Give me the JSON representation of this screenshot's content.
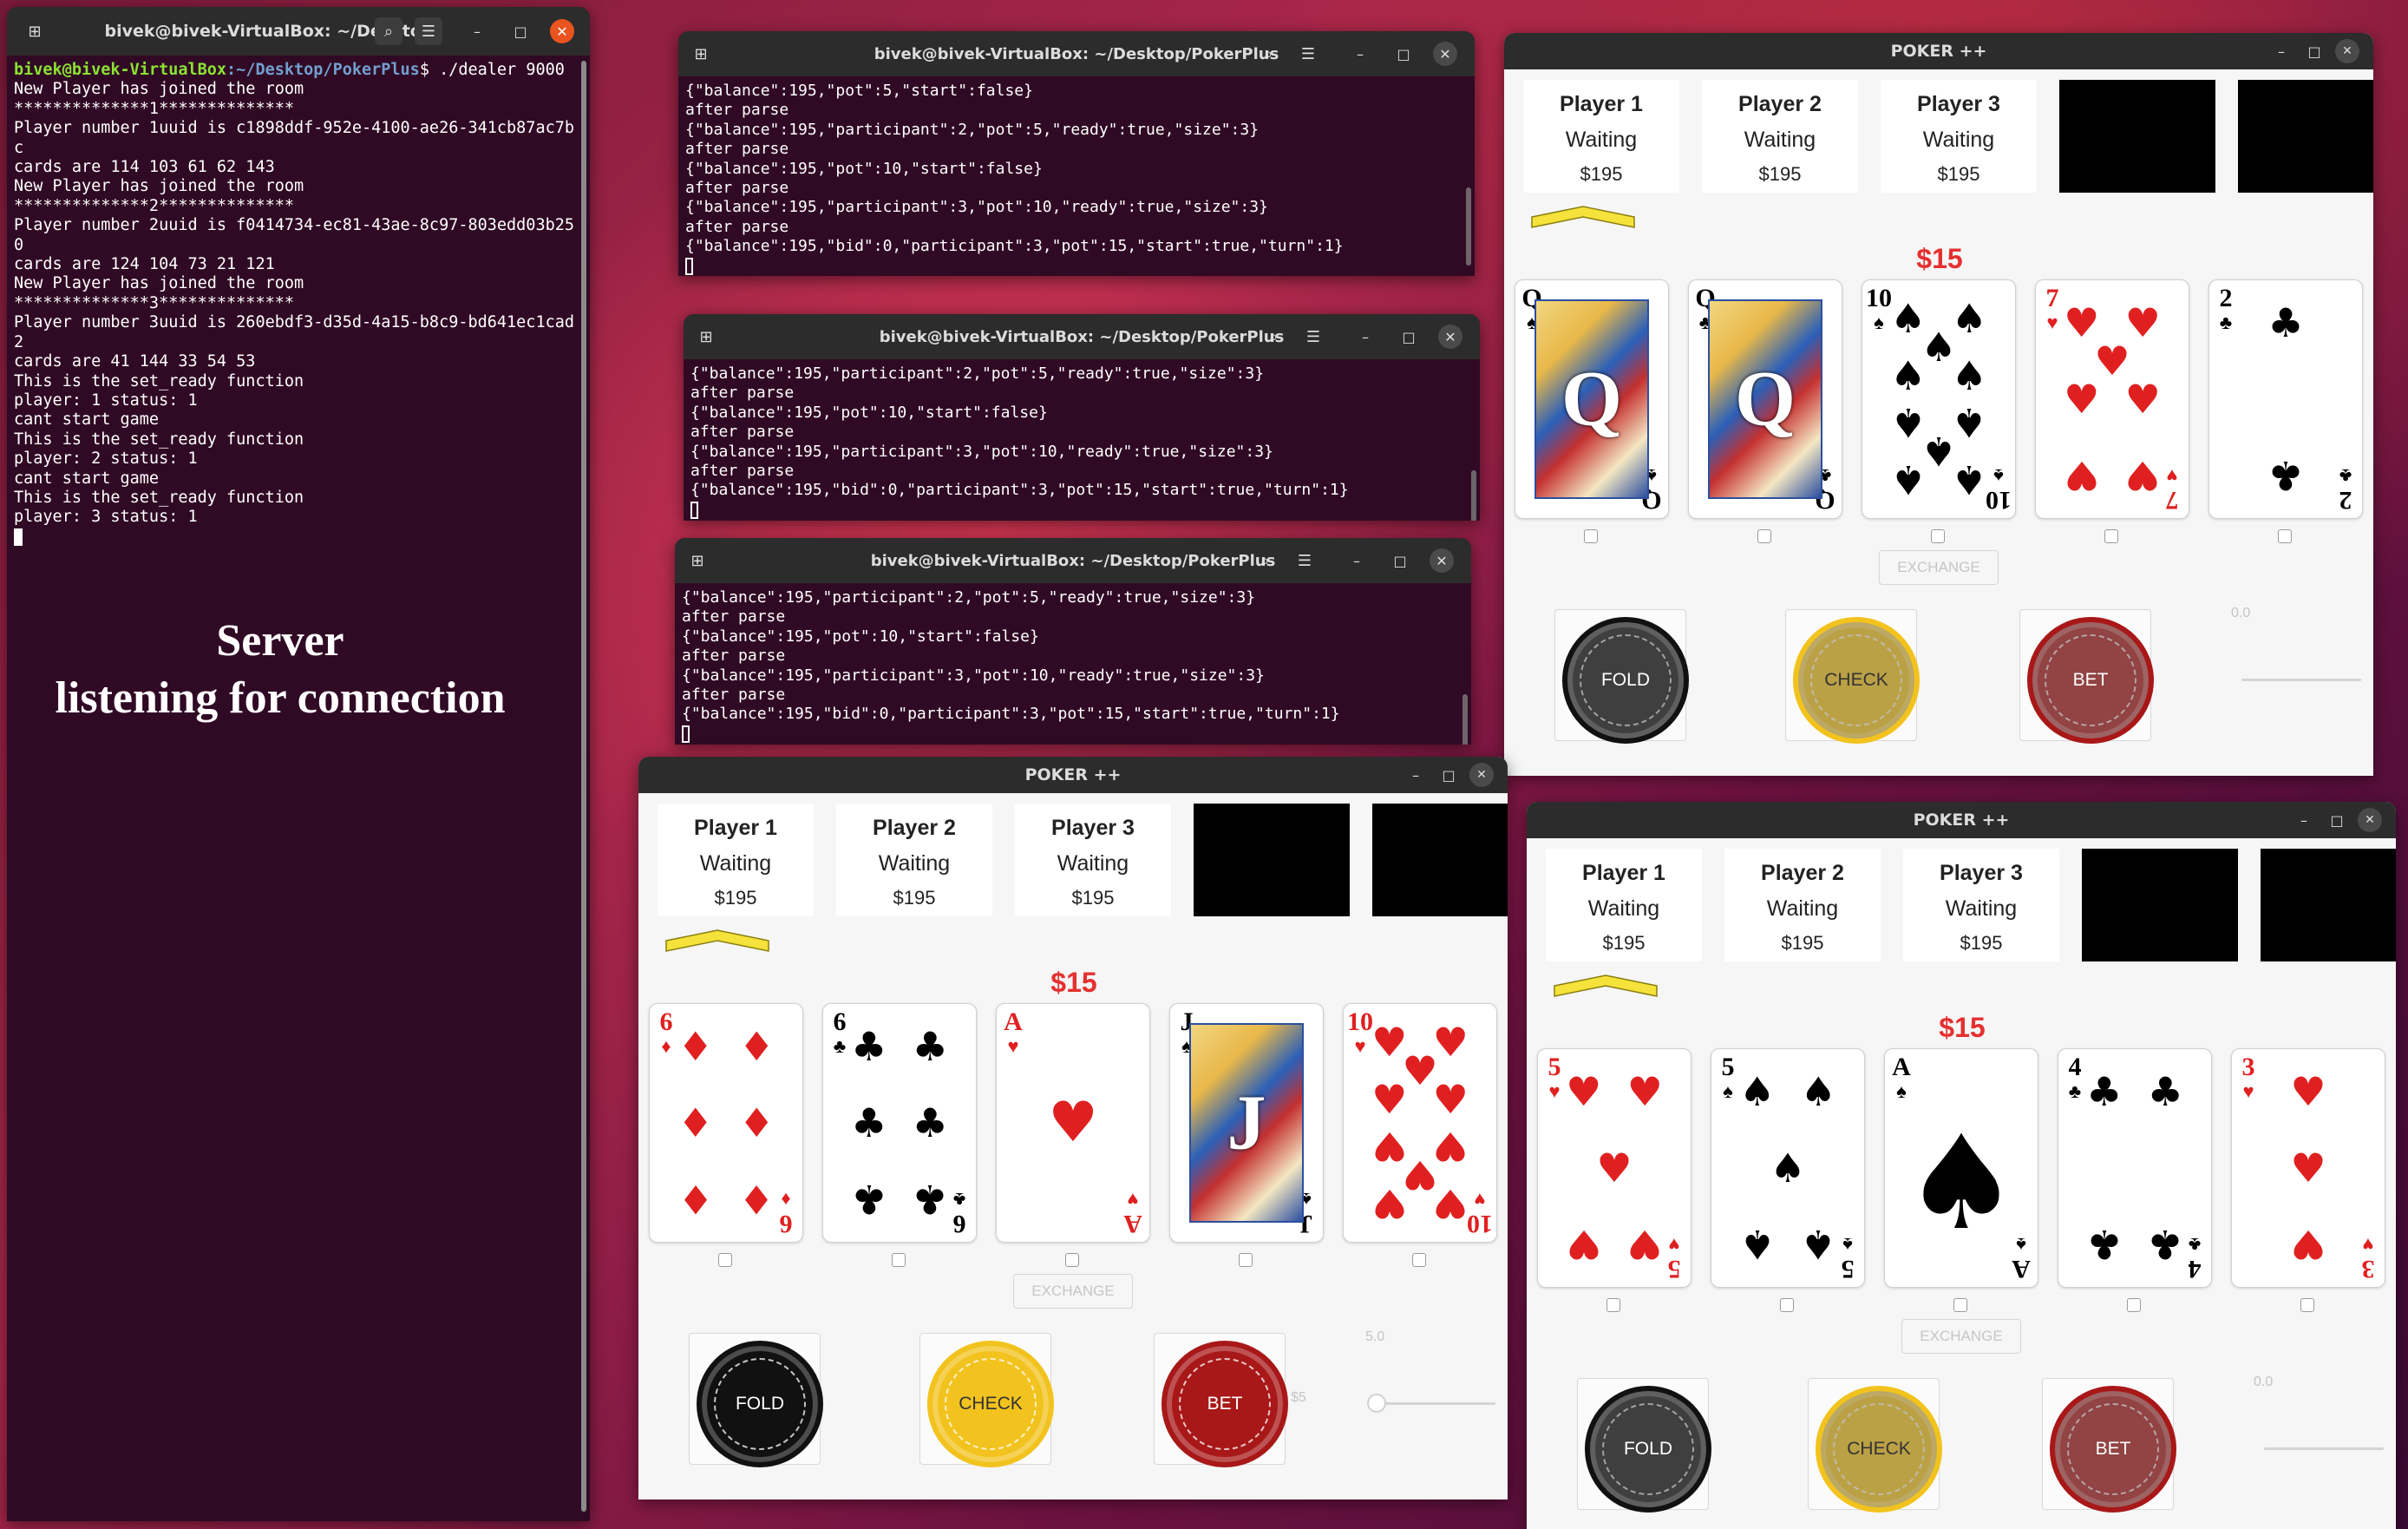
{
  "server_terminal": {
    "title": "bivek@bivek-VirtualBox: ~/Deskto...",
    "prompt_user": "bivek@bivek-VirtualBox",
    "prompt_path": ":~/Desktop/PokerPlus",
    "prompt_cmd": "$ ./dealer 9000",
    "lines": [
      "New Player has joined the room",
      "**************1**************",
      "Player number 1uuid is c1898ddf-952e-4100-ae26-341cb87ac7b",
      "c",
      "cards are 114 103 61 62 143",
      "New Player has joined the room",
      "**************2**************",
      "Player number 2uuid is f0414734-ec81-43ae-8c97-803edd03b25",
      "0",
      "cards are 124 104 73 21 121",
      "New Player has joined the room",
      "**************3**************",
      "Player number 3uuid is 260ebdf3-d35d-4a15-b8c9-bd641ec1cad",
      "2",
      "cards are 41 144 33 54 53",
      "This is the set_ready function",
      "player: 1 status: 1",
      "cant start game",
      "This is the set_ready function",
      "player: 2 status: 1",
      "cant start game",
      "This is the set_ready function",
      "player: 3 status: 1"
    ],
    "caption_line1": "Server",
    "caption_line2": "listening for connection"
  },
  "client_terminals": [
    {
      "title": "bivek@bivek-VirtualBox: ~/Desktop/PokerPlus",
      "lines": [
        "{\"balance\":195,\"pot\":5,\"start\":false}",
        "after parse",
        "{\"balance\":195,\"participant\":2,\"pot\":5,\"ready\":true,\"size\":3}",
        "after parse",
        "{\"balance\":195,\"pot\":10,\"start\":false}",
        "after parse",
        "{\"balance\":195,\"participant\":3,\"pot\":10,\"ready\":true,\"size\":3}",
        "after parse",
        "{\"balance\":195,\"bid\":0,\"participant\":3,\"pot\":15,\"start\":true,\"turn\":1}"
      ]
    },
    {
      "title": "bivek@bivek-VirtualBox: ~/Desktop/PokerPlus",
      "lines": [
        "{\"balance\":195,\"participant\":2,\"pot\":5,\"ready\":true,\"size\":3}",
        "after parse",
        "{\"balance\":195,\"pot\":10,\"start\":false}",
        "after parse",
        "{\"balance\":195,\"participant\":3,\"pot\":10,\"ready\":true,\"size\":3}",
        "after parse",
        "{\"balance\":195,\"bid\":0,\"participant\":3,\"pot\":15,\"start\":true,\"turn\":1}"
      ]
    },
    {
      "title": "bivek@bivek-VirtualBox: ~/Desktop/PokerPlus",
      "lines": [
        "{\"balance\":195,\"participant\":2,\"pot\":5,\"ready\":true,\"size\":3}",
        "after parse",
        "{\"balance\":195,\"pot\":10,\"start\":false}",
        "after parse",
        "{\"balance\":195,\"participant\":3,\"pot\":10,\"ready\":true,\"size\":3}",
        "after parse",
        "{\"balance\":195,\"bid\":0,\"participant\":3,\"pot\":15,\"start\":true,\"turn\":1}"
      ]
    }
  ],
  "poker_windows": [
    {
      "title": "POKER ++",
      "players": [
        {
          "name": "Player 1",
          "status": "Waiting",
          "balance": "$195"
        },
        {
          "name": "Player 2",
          "status": "Waiting",
          "balance": "$195"
        },
        {
          "name": "Player 3",
          "status": "Waiting",
          "balance": "$195"
        }
      ],
      "pot": "$15",
      "cards": [
        {
          "rank": "Q",
          "suit": "♠",
          "color": "#000000",
          "face": true
        },
        {
          "rank": "Q",
          "suit": "♣",
          "color": "#000000",
          "face": true
        },
        {
          "rank": "10",
          "suit": "♠",
          "color": "#000000",
          "count": 10
        },
        {
          "rank": "7",
          "suit": "♥",
          "color": "#e02020",
          "count": 7
        },
        {
          "rank": "2",
          "suit": "♣",
          "color": "#000000",
          "count": 2
        }
      ],
      "exchange_label": "EXCHANGE",
      "fold_label": "FOLD",
      "check_label": "CHECK",
      "bet_label": "BET",
      "bet_amount_label": "",
      "slider_value": "0.0",
      "active": false
    },
    {
      "title": "POKER ++",
      "players": [
        {
          "name": "Player 1",
          "status": "Waiting",
          "balance": "$195"
        },
        {
          "name": "Player 2",
          "status": "Waiting",
          "balance": "$195"
        },
        {
          "name": "Player 3",
          "status": "Waiting",
          "balance": "$195"
        }
      ],
      "pot": "$15",
      "cards": [
        {
          "rank": "6",
          "suit": "♦",
          "color": "#e02020",
          "count": 6
        },
        {
          "rank": "6",
          "suit": "♣",
          "color": "#000000",
          "count": 6
        },
        {
          "rank": "A",
          "suit": "♥",
          "color": "#e02020",
          "count": 1
        },
        {
          "rank": "J",
          "suit": "♠",
          "color": "#000000",
          "face": true
        },
        {
          "rank": "10",
          "suit": "♥",
          "color": "#e02020",
          "count": 10
        }
      ],
      "exchange_label": "EXCHANGE",
      "fold_label": "FOLD",
      "check_label": "CHECK",
      "bet_label": "BET",
      "bet_amount_label": "$5",
      "slider_value": "5.0",
      "active": true
    },
    {
      "title": "POKER ++",
      "players": [
        {
          "name": "Player 1",
          "status": "Waiting",
          "balance": "$195"
        },
        {
          "name": "Player 2",
          "status": "Waiting",
          "balance": "$195"
        },
        {
          "name": "Player 3",
          "status": "Waiting",
          "balance": "$195"
        }
      ],
      "pot": "$15",
      "cards": [
        {
          "rank": "5",
          "suit": "♥",
          "color": "#e02020",
          "count": 5
        },
        {
          "rank": "5",
          "suit": "♠",
          "color": "#000000",
          "count": 5
        },
        {
          "rank": "A",
          "suit": "♠",
          "color": "#000000",
          "count": 1,
          "ace_spade": true
        },
        {
          "rank": "4",
          "suit": "♣",
          "color": "#000000",
          "count": 4
        },
        {
          "rank": "3",
          "suit": "♥",
          "color": "#e02020",
          "count": 3
        }
      ],
      "exchange_label": "EXCHANGE",
      "fold_label": "FOLD",
      "check_label": "CHECK",
      "bet_label": "BET",
      "bet_amount_label": "",
      "slider_value": "0.0",
      "active": false
    }
  ],
  "icons": {
    "new_tab": "new-tab-icon",
    "search": "search-icon",
    "menu": "hamburger-menu-icon",
    "minimize": "minimize-icon",
    "maximize": "maximize-icon",
    "close": "close-icon",
    "turn_indicator": "chevron-up-icon"
  },
  "colors": {
    "terminal_bg": "#300a24",
    "prompt_user": "#8ae234",
    "prompt_path": "#729fcf",
    "pot": "#e53030",
    "turn_indicator": "#f5e23a",
    "close_button": "#e95420"
  }
}
